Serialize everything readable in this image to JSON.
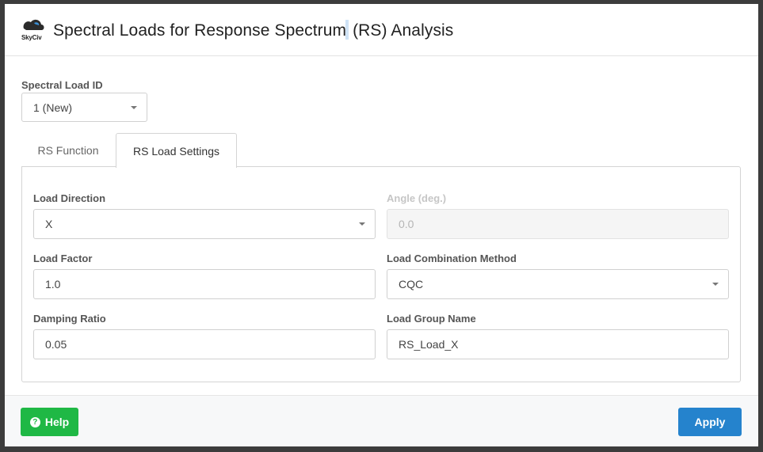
{
  "dialog": {
    "logo_text": "SkyCiv",
    "title_part1": "Spectral Loads for Response Spectrum",
    "title_part2": "(RS) Analysis"
  },
  "spectral_load_id": {
    "label": "Spectral Load ID",
    "value": "1 (New)"
  },
  "tabs": [
    {
      "label": "RS Function",
      "active": false
    },
    {
      "label": "RS Load Settings",
      "active": true
    }
  ],
  "settings": {
    "load_direction": {
      "label": "Load Direction",
      "value": "X"
    },
    "angle": {
      "label": "Angle (deg.)",
      "value": "0.0",
      "disabled": true
    },
    "load_factor": {
      "label": "Load Factor",
      "value": "1.0"
    },
    "combination_method": {
      "label": "Load Combination Method",
      "value": "CQC"
    },
    "damping_ratio": {
      "label": "Damping Ratio",
      "value": "0.05"
    },
    "group_name": {
      "label": "Load Group Name",
      "value": "RS_Load_X"
    }
  },
  "footer": {
    "help_label": "Help",
    "help_icon": "question-circle-icon",
    "apply_label": "Apply"
  },
  "colors": {
    "help_button": "#1fb845",
    "apply_button": "#2583cd"
  }
}
